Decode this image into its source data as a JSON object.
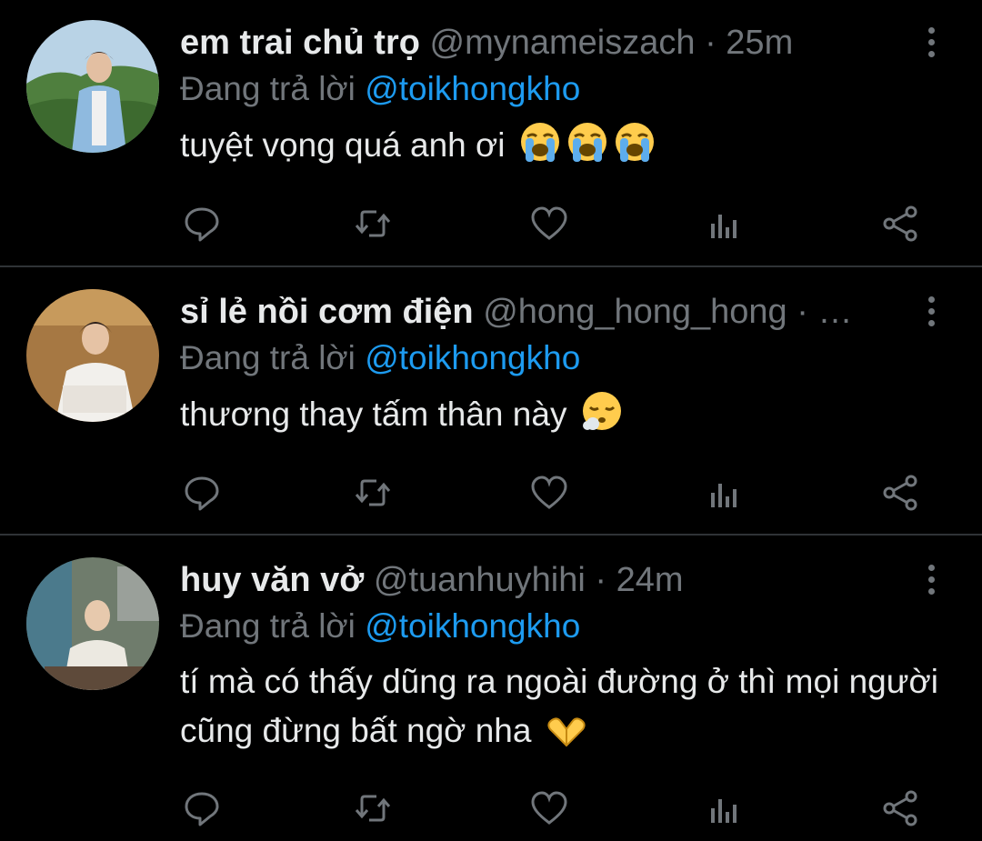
{
  "tweets": [
    {
      "name": "em trai chủ trọ",
      "handle": "@mynameiszach",
      "dot": "·",
      "time": "25m",
      "replying_prefix": "Đang trả lời",
      "replying_to": "@toikhongkho",
      "text": "tuyệt vọng quá anh ơi",
      "emojis": [
        "loudly-crying-face",
        "loudly-crying-face",
        "loudly-crying-face"
      ]
    },
    {
      "name": "sỉ lẻ nồi cơm điện",
      "handle": "@hong_hong_hong",
      "dot": "· …",
      "time": "",
      "replying_prefix": "Đang trả lời",
      "replying_to": "@toikhongkho",
      "text": "thương thay tấm thân này",
      "emojis": [
        "face-exhaling"
      ]
    },
    {
      "name": "huy văn vở",
      "handle": "@tuanhuyhihi",
      "dot": "·",
      "time": "24m",
      "replying_prefix": "Đang trả lời",
      "replying_to": "@toikhongkho",
      "text": "tí mà có thấy dũng ra ngoài đường ở thì mọi người cũng đừng bất ngờ nha",
      "emojis": [
        "heart-hands"
      ]
    }
  ],
  "actions": [
    "reply-icon",
    "retweet-icon",
    "like-icon",
    "analytics-icon",
    "share-icon"
  ],
  "colors": {
    "background": "#000000",
    "text": "#e7e9ea",
    "muted": "#71767b",
    "link": "#1d9bf0",
    "divider": "#2f3336"
  }
}
